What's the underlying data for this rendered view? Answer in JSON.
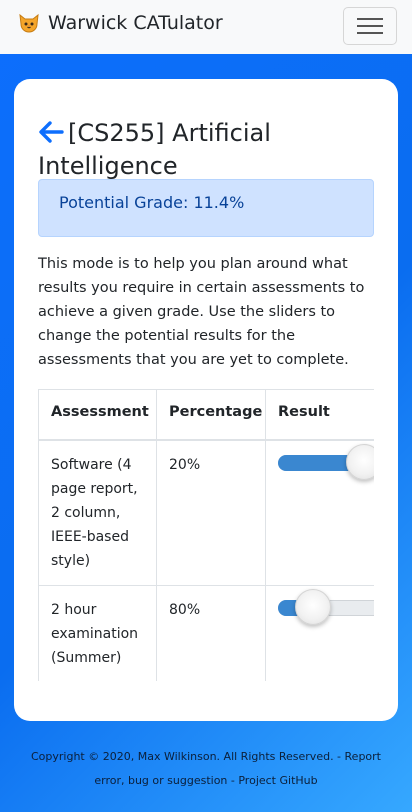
{
  "navbar": {
    "brand_text": "Warwick CATulator",
    "brand_icon": "cat-face-icon",
    "menu_icon": "hamburger-menu-icon"
  },
  "page": {
    "title": "[CS255] Artificial Intelligence",
    "back_icon": "arrow-left-icon"
  },
  "alert": {
    "text": "Potential Grade: 11.4%"
  },
  "description": "This mode is to help you plan around what results you require in certain assessments to achieve a given grade. Use the sliders to change the potential results for the assessments that you are yet to complete.",
  "table": {
    "headers": [
      "Assessment",
      "Percentage",
      "Result"
    ],
    "rows": [
      {
        "assessment": "Software (4 page report, 2 column, IEEE-based style)",
        "percentage": "20%",
        "result_fraction": 0.57
      },
      {
        "assessment": "2 hour examination (Summer)",
        "percentage": "80%",
        "result_fraction": 0.14
      }
    ]
  },
  "footer": {
    "text": "Copyright © 2020, Max Wilkinson. All Rights Reserved. - Report error, bug or suggestion - Project GitHub"
  },
  "colors": {
    "primary": "#0d6efd",
    "alert_bg": "#cfe2ff",
    "alert_text": "#084298",
    "slider_fill": "#3a87d0"
  }
}
